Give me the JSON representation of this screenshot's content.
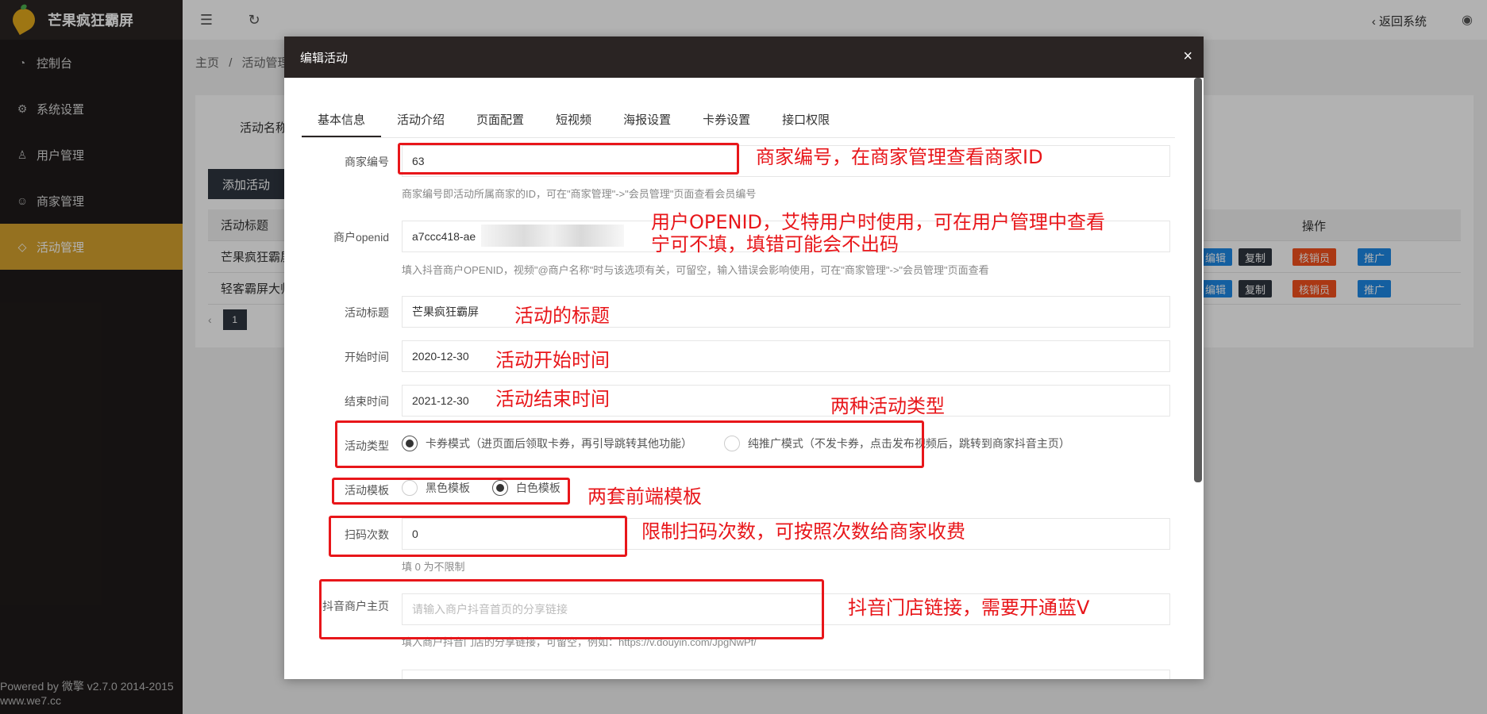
{
  "app": {
    "title": "芒果疯狂霸屏",
    "powered": "Powered by 微擎 v2.7.0 2014-2015",
    "site": "www.we7.cc"
  },
  "sidebar": {
    "items": [
      {
        "label": "控制台",
        "icon": "dashboard-icon"
      },
      {
        "label": "系统设置",
        "icon": "gear-icon"
      },
      {
        "label": "用户管理",
        "icon": "user-icon"
      },
      {
        "label": "商家管理",
        "icon": "smile-icon"
      },
      {
        "label": "活动管理",
        "icon": "tag-icon"
      }
    ]
  },
  "topbar": {
    "back": "返回系统"
  },
  "breadcrumb": {
    "home": "主页",
    "sep": "/",
    "current": "活动管理"
  },
  "background": {
    "filter_label": "活动名称",
    "add_button": "添加活动",
    "table_head": "活动标题",
    "ops_head": "操作",
    "rows": [
      "芒果疯狂霸屏",
      "轻客霸屏大师"
    ],
    "ops": [
      "编辑",
      "复制",
      "核销员",
      "推广",
      "..."
    ],
    "page": "1"
  },
  "modal": {
    "title": "编辑活动",
    "close": "×",
    "tabs": [
      "基本信息",
      "活动介绍",
      "页面配置",
      "短视频",
      "海报设置",
      "卡券设置",
      "接口权限"
    ],
    "merchant_id": {
      "label": "商家编号",
      "value": "63",
      "hint": "商家编号即活动所属商家的ID，可在\"商家管理\"->\"会员管理\"页面查看会员编号"
    },
    "openid": {
      "label": "商户openid",
      "value": "a7ccc418-ae",
      "hint": "填入抖音商户OPENID，视频\"@商户名称\"时与该选项有关，可留空，输入错误会影响使用，可在\"商家管理\"->\"会员管理\"页面查看"
    },
    "title_field": {
      "label": "活动标题",
      "value": "芒果疯狂霸屏"
    },
    "start": {
      "label": "开始时间",
      "value": "2020-12-30"
    },
    "end": {
      "label": "结束时间",
      "value": "2021-12-30"
    },
    "type": {
      "label": "活动类型",
      "options": [
        "卡券模式（进页面后领取卡券，再引导跳转其他功能）",
        "纯推广模式（不发卡券，点击发布视频后，跳转到商家抖音主页）"
      ]
    },
    "template": {
      "label": "活动模板",
      "options": [
        "黑色模板",
        "白色模板"
      ]
    },
    "scan": {
      "label": "扫码次数",
      "value": "0",
      "hint": "填 0 为不限制"
    },
    "douyin": {
      "label": "抖音商户主页",
      "placeholder": "请输入商户抖音首页的分享链接",
      "hint": "填入商户抖音门店的分享链接，可留空，例如：https://v.douyin.com/JpgNwPf/"
    }
  },
  "annotations": {
    "merchant": "商家编号，在商家管理查看商家ID",
    "openid1": "用户OPENID，艾特用户时使用，可在用户管理中查看",
    "openid2": "宁可不填，填错可能会不出码",
    "title": "活动的标题",
    "start": "活动开始时间",
    "end": "活动结束时间",
    "types": "两种活动类型",
    "templates": "两套前端模板",
    "scan": "限制扫码次数，可按照次数给商家收费",
    "douyin": "抖音门店链接，需要开通蓝V"
  },
  "colors": {
    "accent": "#d6a22e",
    "annotation": "#e8161a",
    "dark": "#2a2423"
  }
}
